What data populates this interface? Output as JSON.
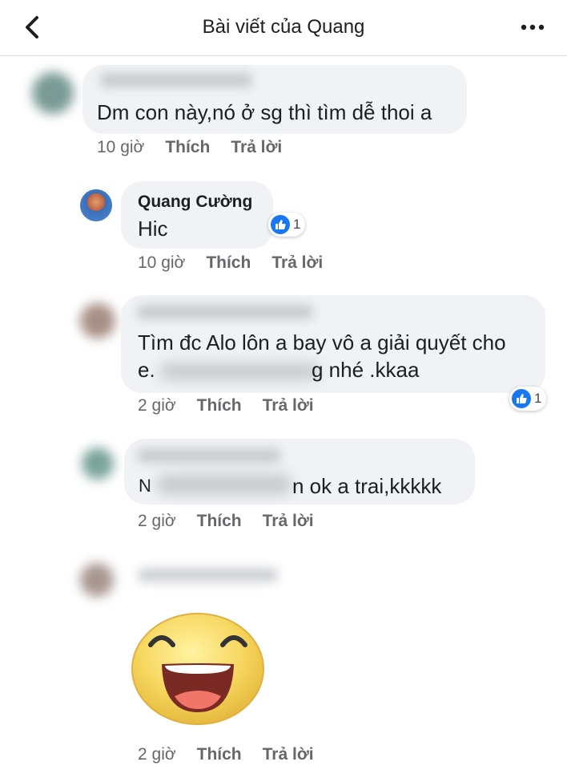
{
  "header": {
    "title": "Bài viết của Quang"
  },
  "actions": {
    "like": "Thích",
    "reply": "Trả lời"
  },
  "comments": [
    {
      "author": "",
      "text_lines": [
        "Dm con này,nó ở sg thì tìm dễ thoi a"
      ],
      "time": "10 giờ"
    },
    {
      "author": "Quang Cường",
      "text_lines": [
        "Hic"
      ],
      "time": "10 giờ",
      "reaction_count": "1"
    },
    {
      "author": "",
      "text_lines": [
        "Tìm đc Alo lôn a bay vô a giải quyết cho",
        "e.",
        "g nhé .kkaa"
      ],
      "time": "2 giờ",
      "reaction_count": "1"
    },
    {
      "author": "",
      "text_lines": [
        "N",
        "n ok a trai,kkkkk"
      ],
      "time": "2 giờ"
    },
    {
      "author": "",
      "sticker": "laughing-smiley-sticker",
      "time": "2 giờ"
    }
  ],
  "colors": {
    "bubble": "#f0f2f5",
    "like_blue": "#1877f2",
    "meta_gray": "#65676b",
    "text": "#1c1e21"
  }
}
